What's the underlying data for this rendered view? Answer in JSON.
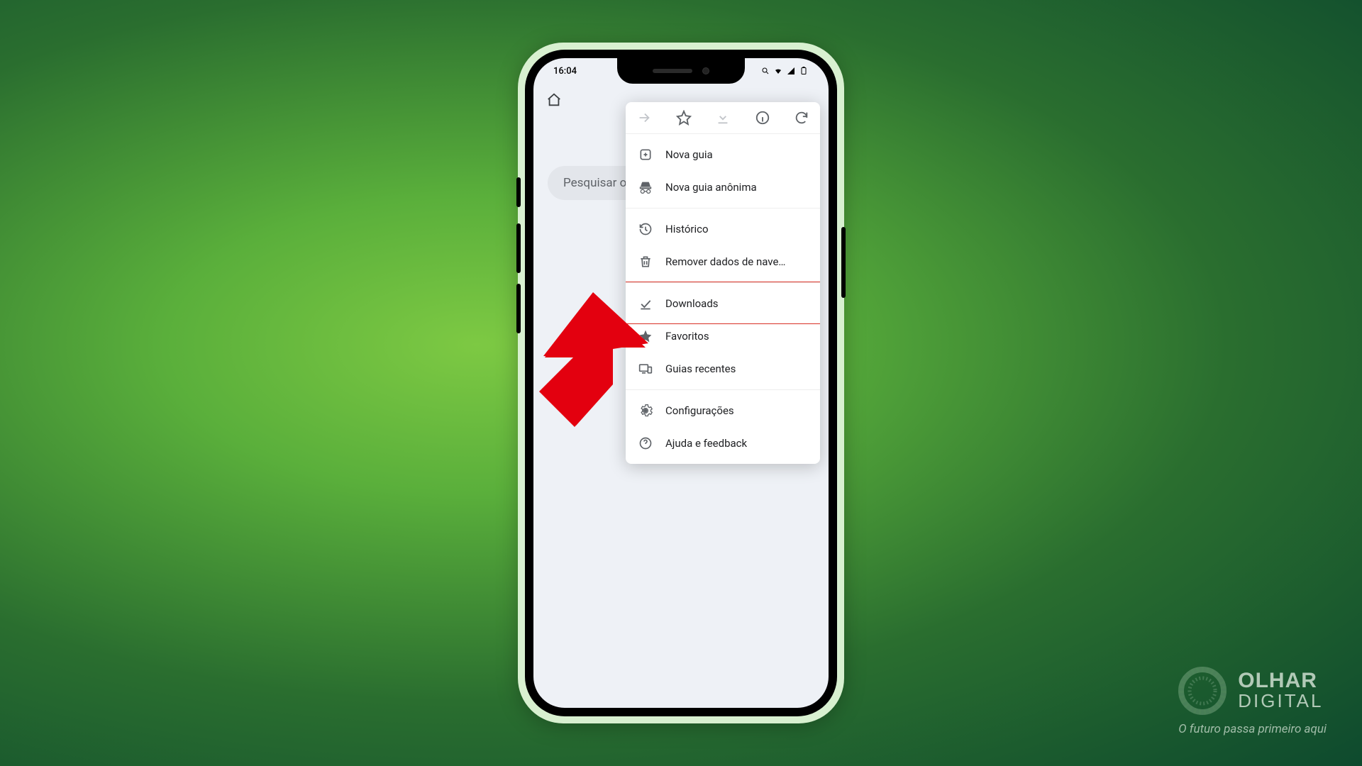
{
  "statusbar": {
    "time": "16:04"
  },
  "search": {
    "placeholder": "Pesquisar ou"
  },
  "menu": {
    "new_tab": "Nova guia",
    "incognito": "Nova guia anônima",
    "history": "Histórico",
    "clear_data": "Remover dados de nave…",
    "downloads": "Downloads",
    "bookmarks": "Favoritos",
    "recent_tabs": "Guias recentes",
    "settings": "Configurações",
    "help": "Ajuda e feedback"
  },
  "brand": {
    "line1": "OLHAR",
    "line2": "DIGITAL",
    "tagline": "O futuro passa primeiro aqui"
  }
}
